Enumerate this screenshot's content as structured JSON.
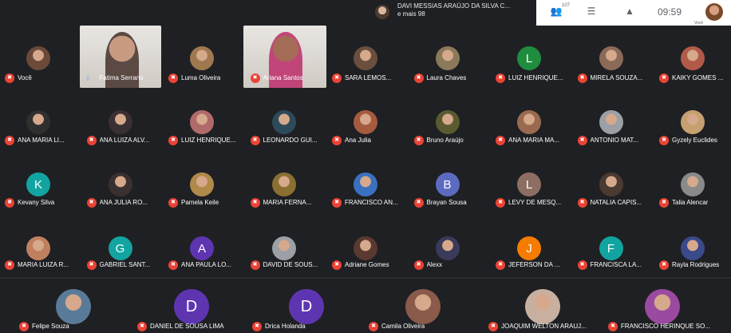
{
  "colors": {
    "mic_muted": "#ea4335",
    "mic_active": "#8ab4f8",
    "background": "#1f2023"
  },
  "topbar": {
    "pinned_line1": "DAVI MESSIAS ARAÚJO DA SILVA C...",
    "pinned_line2": "e mais 98",
    "people_badge": "107",
    "clock": "09:59",
    "self_label": "Você"
  },
  "icons": {
    "mic_muted": "mic-off-icon",
    "mic_active": "sound-wave-icon",
    "people": "people-icon",
    "chat": "chat-icon",
    "activities": "activities-icon"
  },
  "participants": [
    {
      "name": "Você",
      "type": "photo",
      "color": "#6b4a3a",
      "muted": true
    },
    {
      "name": "Fatima Serrano",
      "type": "video",
      "color": "#5b4a44",
      "muted": false
    },
    {
      "name": "Luma Oliveira",
      "type": "photo",
      "color": "#a07850",
      "muted": true
    },
    {
      "name": "Ariana Santos",
      "type": "video",
      "color": "#c2457a",
      "muted": true
    },
    {
      "name": "SARA LEMOS...",
      "type": "photo",
      "color": "#6a4e3e",
      "muted": true
    },
    {
      "name": "Laura Chaves",
      "type": "photo",
      "color": "#8a7a5a",
      "muted": true
    },
    {
      "name": "LUIZ HENRIQUE...",
      "type": "letter",
      "letter": "L",
      "color": "#1e8e3e",
      "muted": true
    },
    {
      "name": "MIRELA SOUZA...",
      "type": "photo",
      "color": "#8c6a58",
      "muted": true
    },
    {
      "name": "KAIKY GOMES ...",
      "type": "photo",
      "color": "#b25a4a",
      "muted": true
    },
    {
      "name": "ANA MARIA LI...",
      "type": "photo",
      "color": "#2f2f2f",
      "muted": true
    },
    {
      "name": "ANA LUIZA ALV...",
      "type": "photo",
      "color": "#3a2f33",
      "muted": true
    },
    {
      "name": "LUIZ HENRIQUE...",
      "type": "photo",
      "color": "#b06a6a",
      "muted": true
    },
    {
      "name": "LEONARDO GUI...",
      "type": "photo",
      "color": "#2c4a5a",
      "muted": true
    },
    {
      "name": "Ana Julia",
      "type": "photo",
      "color": "#a65a40",
      "muted": true
    },
    {
      "name": "Bruno Araújo",
      "type": "photo",
      "color": "#5a5a30",
      "muted": true
    },
    {
      "name": "ANA MARIA MA...",
      "type": "photo",
      "color": "#9a6a50",
      "muted": true
    },
    {
      "name": "ANTONIO MAT...",
      "type": "photo",
      "color": "#9aa0a6",
      "muted": true
    },
    {
      "name": "Gyzely Euclides",
      "type": "photo",
      "color": "#c7a070",
      "muted": true
    },
    {
      "name": "Kevany Silva",
      "type": "letter",
      "letter": "K",
      "color": "#12a4a0",
      "muted": true
    },
    {
      "name": "ANA JULIA RO...",
      "type": "photo",
      "color": "#3a3030",
      "muted": true
    },
    {
      "name": "Pamela Keile",
      "type": "photo",
      "color": "#b08a4a",
      "muted": true
    },
    {
      "name": "MARIA FERNA...",
      "type": "photo",
      "color": "#8a7030",
      "muted": true
    },
    {
      "name": "FRANCISCO AN...",
      "type": "photo",
      "color": "#3a70c0",
      "muted": true
    },
    {
      "name": "Brayan Sousa",
      "type": "letter",
      "letter": "B",
      "color": "#5c6bc0",
      "muted": true
    },
    {
      "name": "LEVY DE MESQ...",
      "type": "letter",
      "letter": "L",
      "color": "#8d6e63",
      "muted": true
    },
    {
      "name": "NATALIA CAPIS...",
      "type": "photo",
      "color": "#4a3a30",
      "muted": true
    },
    {
      "name": "Talia Alencar",
      "type": "photo",
      "color": "#8a8a8a",
      "muted": true
    },
    {
      "name": "MARIA LUIZA R...",
      "type": "photo",
      "color": "#c08060",
      "muted": true
    },
    {
      "name": "GABRIEL SANT...",
      "type": "letter",
      "letter": "G",
      "color": "#12a4a0",
      "muted": true
    },
    {
      "name": "ANA PAULA LO...",
      "type": "letter",
      "letter": "A",
      "color": "#5e35b1",
      "muted": true
    },
    {
      "name": "DAVID DE SOUS...",
      "type": "photo",
      "color": "#9aa0a6",
      "muted": true
    },
    {
      "name": "Adriane Gomes",
      "type": "photo",
      "color": "#5a3a30",
      "muted": true
    },
    {
      "name": "Alexx",
      "type": "photo",
      "color": "#3a3a5a",
      "muted": true
    },
    {
      "name": "JEFERSON DA ...",
      "type": "letter",
      "letter": "J",
      "color": "#f57c00",
      "muted": true
    },
    {
      "name": "FRANCISCA LA...",
      "type": "letter",
      "letter": "F",
      "color": "#12a4a0",
      "muted": true
    },
    {
      "name": "Rayla Rodrigues",
      "type": "photo",
      "color": "#3a4a8a",
      "muted": true
    },
    {
      "name": "Felipe Souza",
      "type": "photo",
      "color": "#5a7a9a",
      "muted": true,
      "big": true
    },
    {
      "name": "DANIEL DE SOUSA LIMA",
      "type": "letter",
      "letter": "D",
      "color": "#5e35b1",
      "muted": true,
      "big": true
    },
    {
      "name": "Drica Holanda",
      "type": "letter",
      "letter": "D",
      "color": "#5e35b1",
      "muted": true,
      "big": true
    },
    {
      "name": "Camila Oliveira",
      "type": "photo",
      "color": "#8a5a4a",
      "muted": true,
      "big": true
    },
    {
      "name": "JOAQUIM WELTON ARAUJ...",
      "type": "photo",
      "color": "#c8b0a0",
      "muted": true,
      "big": true
    },
    {
      "name": "FRANCISCO HERINQUE SO...",
      "type": "photo",
      "color": "#9a4aa0",
      "muted": true,
      "big": true
    }
  ]
}
